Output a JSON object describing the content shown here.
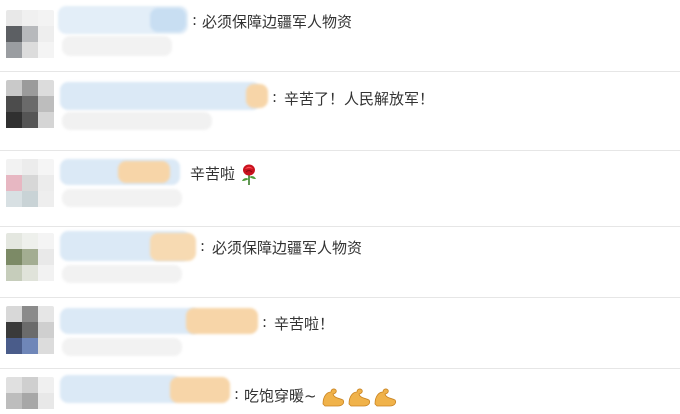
{
  "comments": [
    {
      "text": "必须保障边疆军人物资"
    },
    {
      "text": "辛苦了！人民解放军！"
    },
    {
      "text": "辛苦啦",
      "emoji": "rose-emoji"
    },
    {
      "text": "必须保障边疆军人物资"
    },
    {
      "text": "辛苦啦！"
    },
    {
      "text": "吃饱穿暖~",
      "emoji": "flexed-biceps-emoji x3"
    }
  ],
  "colors": {
    "divider": "#e6e6e6",
    "text": "#333333",
    "blur_blue": "#cfe3f4",
    "blur_orange": "#f7d5a8"
  }
}
